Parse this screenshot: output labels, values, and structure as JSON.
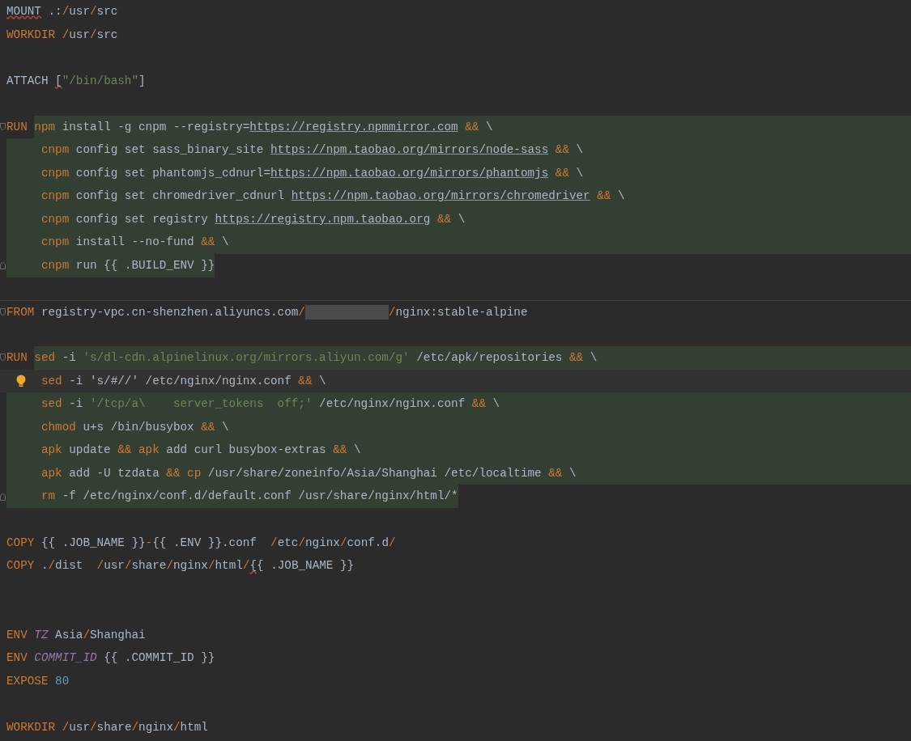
{
  "editor": {
    "lines": [
      {
        "kind": "code",
        "tokens": [
          {
            "text": "MOUNT",
            "kind": "plain",
            "err": true
          },
          {
            "text": " .:",
            "kind": "plain"
          },
          {
            "text": "/",
            "kind": "op"
          },
          {
            "text": "usr",
            "kind": "plain"
          },
          {
            "text": "/",
            "kind": "op"
          },
          {
            "text": "src",
            "kind": "plain"
          }
        ]
      },
      {
        "kind": "code",
        "tokens": [
          {
            "text": "WORKDIR ",
            "kind": "kw"
          },
          {
            "text": "/",
            "kind": "op"
          },
          {
            "text": "usr",
            "kind": "plain"
          },
          {
            "text": "/",
            "kind": "op"
          },
          {
            "text": "src",
            "kind": "plain"
          }
        ]
      },
      {
        "kind": "blank"
      },
      {
        "kind": "code",
        "tokens": [
          {
            "text": "ATTACH ",
            "kind": "plain"
          },
          {
            "text": "[",
            "kind": "plain",
            "err": true
          },
          {
            "text": "\"/bin/bash\"",
            "kind": "str"
          },
          {
            "text": "]",
            "kind": "plain"
          }
        ]
      },
      {
        "kind": "blank"
      },
      {
        "kind": "code",
        "highlighted": true,
        "highlight_after_instruction": true,
        "fold_start": true,
        "tokens": [
          {
            "text": "RUN ",
            "kind": "kw"
          },
          {
            "text": "npm",
            "kind": "cmd"
          },
          {
            "text": " install -g cnpm --registry=",
            "kind": "plain"
          },
          {
            "text": "https://registry.npmmirror.com",
            "kind": "link"
          },
          {
            "text": " &&",
            "kind": "op"
          },
          {
            "text": " \\",
            "kind": "plain"
          }
        ]
      },
      {
        "kind": "code",
        "highlighted": true,
        "indent": true,
        "tokens": [
          {
            "text": "cnpm",
            "kind": "cmd"
          },
          {
            "text": " config set sass_binary_site ",
            "kind": "plain"
          },
          {
            "text": "https://npm.taobao.org/mirrors/node-sass",
            "kind": "link"
          },
          {
            "text": " &&",
            "kind": "op"
          },
          {
            "text": " \\",
            "kind": "plain"
          }
        ]
      },
      {
        "kind": "code",
        "highlighted": true,
        "indent": true,
        "tokens": [
          {
            "text": "cnpm",
            "kind": "cmd"
          },
          {
            "text": " config set phantomjs_cdnurl=",
            "kind": "plain"
          },
          {
            "text": "https://npm.taobao.org/mirrors/phantomjs",
            "kind": "link"
          },
          {
            "text": " &&",
            "kind": "op"
          },
          {
            "text": " \\",
            "kind": "plain"
          }
        ]
      },
      {
        "kind": "code",
        "highlighted": true,
        "indent": true,
        "tokens": [
          {
            "text": "cnpm",
            "kind": "cmd"
          },
          {
            "text": " config set chromedriver_cdnurl ",
            "kind": "plain"
          },
          {
            "text": "https://npm.taobao.org/mirrors/chromedriver",
            "kind": "link"
          },
          {
            "text": " &&",
            "kind": "op"
          },
          {
            "text": " \\",
            "kind": "plain"
          }
        ]
      },
      {
        "kind": "code",
        "highlighted": true,
        "indent": true,
        "tokens": [
          {
            "text": "cnpm",
            "kind": "cmd"
          },
          {
            "text": " config set registry ",
            "kind": "plain"
          },
          {
            "text": "https://registry.npm.taobao.org",
            "kind": "link"
          },
          {
            "text": " &&",
            "kind": "op"
          },
          {
            "text": " \\",
            "kind": "plain"
          }
        ]
      },
      {
        "kind": "code",
        "highlighted": true,
        "indent": true,
        "tokens": [
          {
            "text": "cnpm",
            "kind": "cmd"
          },
          {
            "text": " install --no-fund ",
            "kind": "plain"
          },
          {
            "text": "&&",
            "kind": "op"
          },
          {
            "text": " \\",
            "kind": "plain"
          }
        ]
      },
      {
        "kind": "code",
        "highlighted": true,
        "highlight_to_text_end": true,
        "indent": true,
        "fold_end": true,
        "tokens": [
          {
            "text": "cnpm",
            "kind": "cmd"
          },
          {
            "text": " run {{ .BUILD_ENV }}",
            "kind": "plain"
          }
        ]
      },
      {
        "kind": "blank"
      },
      {
        "kind": "code",
        "separator": true,
        "fold_start": true,
        "tokens": [
          {
            "text": "FROM",
            "kind": "kw"
          },
          {
            "text": " registry-vpc.cn-shenzhen.aliyuncs.com",
            "kind": "plain"
          },
          {
            "text": "/",
            "kind": "op"
          },
          {
            "kind": "redacted"
          },
          {
            "text": "/",
            "kind": "op"
          },
          {
            "text": "nginx:stable-alpine",
            "kind": "plain"
          }
        ]
      },
      {
        "kind": "blank"
      },
      {
        "kind": "code",
        "highlighted": true,
        "highlight_after_instruction": true,
        "fold_start": true,
        "tokens": [
          {
            "text": "RUN ",
            "kind": "kw"
          },
          {
            "text": "sed",
            "kind": "cmd"
          },
          {
            "text": " -i ",
            "kind": "plain"
          },
          {
            "text": "'s/dl-cdn.alpinelinux.org/mirrors.aliyun.com/g'",
            "kind": "str"
          },
          {
            "text": " /etc/apk/repositories ",
            "kind": "plain"
          },
          {
            "text": "&&",
            "kind": "op"
          },
          {
            "text": " \\",
            "kind": "plain"
          }
        ]
      },
      {
        "kind": "code",
        "current": true,
        "bulb": true,
        "indent": true,
        "tokens": [
          {
            "text": "sed",
            "kind": "cmd"
          },
          {
            "text": " -i 's/#//' /etc/nginx/nginx.conf ",
            "kind": "plain"
          },
          {
            "text": "&&",
            "kind": "op"
          },
          {
            "text": " \\",
            "kind": "plain"
          }
        ]
      },
      {
        "kind": "code",
        "highlighted": true,
        "indent": true,
        "tokens": [
          {
            "text": "sed",
            "kind": "cmd"
          },
          {
            "text": " -i ",
            "kind": "plain"
          },
          {
            "text": "'/tcp/a\\    server_tokens  off;'",
            "kind": "str"
          },
          {
            "text": " /etc/nginx/nginx.conf ",
            "kind": "plain"
          },
          {
            "text": "&&",
            "kind": "op"
          },
          {
            "text": " \\",
            "kind": "plain"
          }
        ]
      },
      {
        "kind": "code",
        "highlighted": true,
        "indent": true,
        "tokens": [
          {
            "text": "chmod",
            "kind": "cmd"
          },
          {
            "text": " u+s /bin/busybox ",
            "kind": "plain"
          },
          {
            "text": "&&",
            "kind": "op"
          },
          {
            "text": " \\",
            "kind": "plain"
          }
        ]
      },
      {
        "kind": "code",
        "highlighted": true,
        "indent": true,
        "tokens": [
          {
            "text": "apk",
            "kind": "cmd"
          },
          {
            "text": " update ",
            "kind": "plain"
          },
          {
            "text": "&& apk",
            "kind": "op"
          },
          {
            "text": " add curl busybox-extras ",
            "kind": "plain"
          },
          {
            "text": "&&",
            "kind": "op"
          },
          {
            "text": " \\",
            "kind": "plain"
          }
        ]
      },
      {
        "kind": "code",
        "highlighted": true,
        "indent": true,
        "tokens": [
          {
            "text": "apk",
            "kind": "cmd"
          },
          {
            "text": " add -U tzdata ",
            "kind": "plain"
          },
          {
            "text": "&& cp",
            "kind": "op"
          },
          {
            "text": " /usr/share/zoneinfo/Asia/Shanghai /etc/localtime ",
            "kind": "plain"
          },
          {
            "text": "&&",
            "kind": "op"
          },
          {
            "text": " \\",
            "kind": "plain"
          }
        ]
      },
      {
        "kind": "code",
        "highlighted": true,
        "highlight_to_text_end": true,
        "indent": true,
        "fold_end": true,
        "tokens": [
          {
            "text": "rm",
            "kind": "cmd"
          },
          {
            "text": " -f /etc/nginx/conf.d/default.conf /usr/share/nginx/html/*",
            "kind": "plain"
          }
        ]
      },
      {
        "kind": "blank"
      },
      {
        "kind": "code",
        "tokens": [
          {
            "text": "COPY",
            "kind": "kw"
          },
          {
            "text": " {{ .JOB_NAME }}",
            "kind": "plain"
          },
          {
            "text": "-",
            "kind": "op"
          },
          {
            "text": "{{ .ENV }}.conf  ",
            "kind": "plain"
          },
          {
            "text": "/",
            "kind": "op"
          },
          {
            "text": "etc",
            "kind": "plain"
          },
          {
            "text": "/",
            "kind": "op"
          },
          {
            "text": "nginx",
            "kind": "plain"
          },
          {
            "text": "/",
            "kind": "op"
          },
          {
            "text": "conf.d",
            "kind": "plain"
          },
          {
            "text": "/",
            "kind": "op"
          }
        ]
      },
      {
        "kind": "code",
        "tokens": [
          {
            "text": "COPY",
            "kind": "kw"
          },
          {
            "text": " .",
            "kind": "plain"
          },
          {
            "text": "/",
            "kind": "op"
          },
          {
            "text": "dist  ",
            "kind": "plain"
          },
          {
            "text": "/",
            "kind": "op"
          },
          {
            "text": "usr",
            "kind": "plain"
          },
          {
            "text": "/",
            "kind": "op"
          },
          {
            "text": "share",
            "kind": "plain"
          },
          {
            "text": "/",
            "kind": "op"
          },
          {
            "text": "nginx",
            "kind": "plain"
          },
          {
            "text": "/",
            "kind": "op"
          },
          {
            "text": "html",
            "kind": "plain"
          },
          {
            "text": "/",
            "kind": "op"
          },
          {
            "text": "{",
            "kind": "plain",
            "err": true
          },
          {
            "text": "{ .JOB_NAME }}",
            "kind": "plain"
          }
        ]
      },
      {
        "kind": "blank"
      },
      {
        "kind": "blank"
      },
      {
        "kind": "code",
        "tokens": [
          {
            "text": "ENV ",
            "kind": "kw"
          },
          {
            "text": "TZ",
            "kind": "var"
          },
          {
            "text": " Asia",
            "kind": "plain"
          },
          {
            "text": "/",
            "kind": "op"
          },
          {
            "text": "Shanghai",
            "kind": "plain"
          }
        ]
      },
      {
        "kind": "code",
        "tokens": [
          {
            "text": "ENV ",
            "kind": "kw"
          },
          {
            "text": "COMMIT_ID",
            "kind": "var"
          },
          {
            "text": " {{ .COMMIT_ID }}",
            "kind": "plain"
          }
        ]
      },
      {
        "kind": "code",
        "tokens": [
          {
            "text": "EXPOSE ",
            "kind": "kw"
          },
          {
            "text": "80",
            "kind": "num"
          }
        ]
      },
      {
        "kind": "blank"
      },
      {
        "kind": "code",
        "tokens": [
          {
            "text": "WORKDIR ",
            "kind": "kw"
          },
          {
            "text": "/",
            "kind": "op"
          },
          {
            "text": "usr",
            "kind": "plain"
          },
          {
            "text": "/",
            "kind": "op"
          },
          {
            "text": "share",
            "kind": "plain"
          },
          {
            "text": "/",
            "kind": "op"
          },
          {
            "text": "nginx",
            "kind": "plain"
          },
          {
            "text": "/",
            "kind": "op"
          },
          {
            "text": "html",
            "kind": "plain"
          }
        ]
      }
    ]
  }
}
